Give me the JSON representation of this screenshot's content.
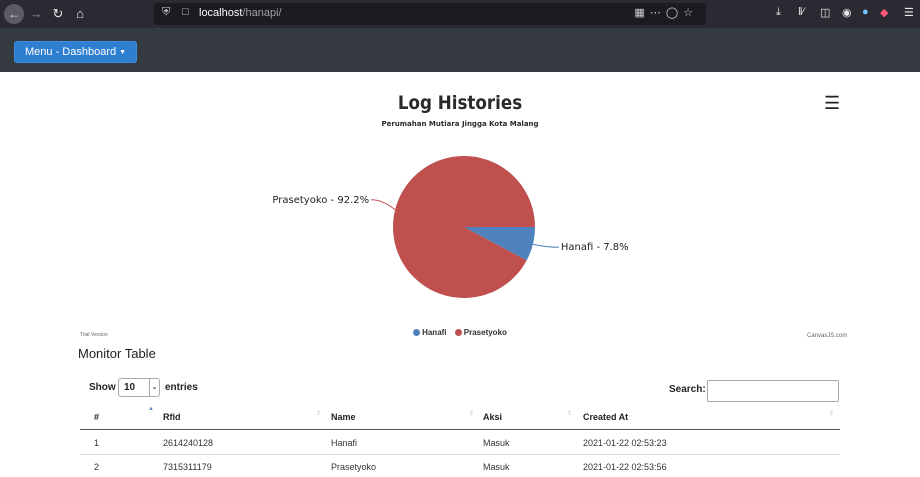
{
  "browser": {
    "url_host": "localhost",
    "url_path": "/hanapi/"
  },
  "navbar": {
    "menu_label": "Menu - Dashboard"
  },
  "chart_data": {
    "type": "pie",
    "title": "Log Histories",
    "subtitle": "Perumahan Mutiara Jingga Kota Malang",
    "slices": [
      {
        "label": "Prasetyoko",
        "percent": 92.2,
        "color": "#c0504e",
        "data_label": "Prasetyoko - 92.2%"
      },
      {
        "label": "Hanafi",
        "percent": 7.8,
        "color": "#4f81bc",
        "data_label": "Hanafi - 7.8%"
      }
    ],
    "legend": [
      "Hanafi",
      "Prasetyoko"
    ],
    "legend_colors": [
      "#4f81bc",
      "#c0504e"
    ],
    "legend_position": "bottom",
    "watermark_left": "Trial Version",
    "watermark_right": "CanvasJS.com"
  },
  "table": {
    "title": "Monitor Table",
    "show_label": "Show",
    "page_length": "10",
    "entries_label": "entries",
    "search_label": "Search:",
    "search_value": "",
    "columns": [
      "#",
      "Rfid",
      "Name",
      "Aksi",
      "Created At"
    ],
    "rows": [
      [
        "1",
        "2614240128",
        "Hanafi",
        "Masuk",
        "2021-01-22 02:53:23"
      ],
      [
        "2",
        "7315311179",
        "Prasetyoko",
        "Masuk",
        "2021-01-22 02:53:56"
      ]
    ]
  }
}
